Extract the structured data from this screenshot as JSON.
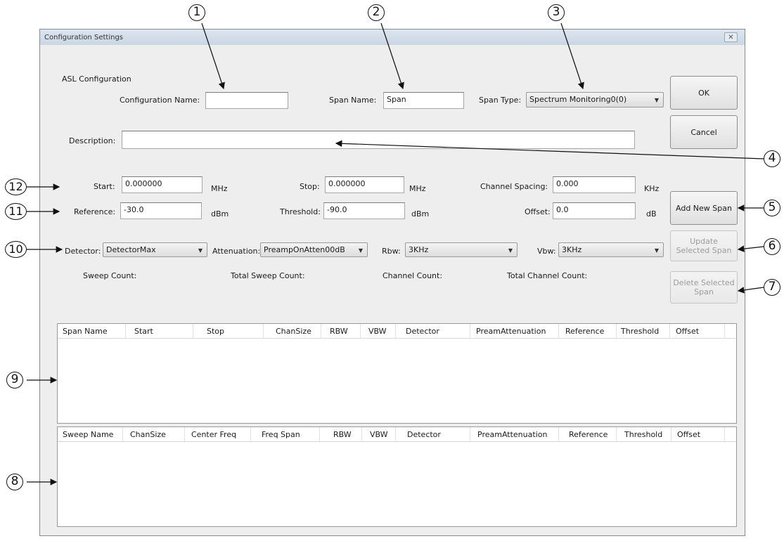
{
  "window": {
    "title": "Configuration Settings",
    "close_glyph": "✕"
  },
  "section_title": "ASL Configuration",
  "fields": {
    "configuration_name": {
      "label": "Configuration Name:",
      "value": ""
    },
    "span_name": {
      "label": "Span Name:",
      "value": "Span"
    },
    "span_type": {
      "label": "Span Type:",
      "value": "Spectrum Monitoring0(0)"
    },
    "description": {
      "label": "Description:",
      "value": ""
    },
    "start": {
      "label": "Start:",
      "value": "0.000000",
      "unit": "MHz"
    },
    "stop": {
      "label": "Stop:",
      "value": "0.000000",
      "unit": "MHz"
    },
    "channel_spacing": {
      "label": "Channel Spacing:",
      "value": "0.000",
      "unit": "KHz"
    },
    "reference": {
      "label": "Reference:",
      "value": "-30.0",
      "unit": "dBm"
    },
    "threshold": {
      "label": "Threshold:",
      "value": "-90.0",
      "unit": "dBm"
    },
    "offset": {
      "label": "Offset:",
      "value": "0.0",
      "unit": "dB"
    },
    "detector": {
      "label": "Detector:",
      "value": "DetectorMax"
    },
    "attenuation": {
      "label": "Attenuation:",
      "value": "PreampOnAtten00dB"
    },
    "rbw": {
      "label": "Rbw:",
      "value": "3KHz"
    },
    "vbw": {
      "label": "Vbw:",
      "value": "3KHz"
    }
  },
  "counts": {
    "sweep_count": "Sweep Count:",
    "total_sweep_count": "Total Sweep Count:",
    "channel_count": "Channel Count:",
    "total_channel_count": "Total Channel Count:"
  },
  "buttons": {
    "ok": "OK",
    "cancel": "Cancel",
    "add_new_span": "Add New Span",
    "update_selected_span_1": "Update",
    "update_selected_span_2": "Selected Span",
    "delete_selected_span_1": "Delete Selected",
    "delete_selected_span_2": "Span"
  },
  "span_table": {
    "columns": [
      "Span Name",
      "Start",
      "Stop",
      "ChanSize",
      "RBW",
      "VBW",
      "Detector",
      "PreamAttenuation",
      "Reference",
      "Threshold",
      "Offset"
    ]
  },
  "sweep_table": {
    "columns": [
      "Sweep Name",
      "ChanSize",
      "Center Freq",
      "Freq Span",
      "RBW",
      "VBW",
      "Detector",
      "PreamAttenuation",
      "Reference",
      "Threshold",
      "Offset"
    ]
  },
  "callouts": [
    "1",
    "2",
    "3",
    "4",
    "5",
    "6",
    "7",
    "8",
    "9",
    "10",
    "11",
    "12"
  ],
  "icons": {
    "dropdown": "chevron-down-icon",
    "close": "close-icon"
  }
}
